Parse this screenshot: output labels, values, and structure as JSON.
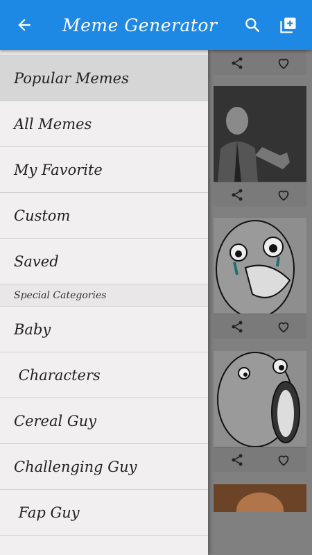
{
  "appbar": {
    "title": "Meme Generator",
    "color": "#1e88e5",
    "icons": [
      "back-arrow-icon",
      "search-icon",
      "add-box-icon"
    ]
  },
  "drawer": {
    "items_top": [
      {
        "label": "Popular Memes",
        "active": true
      },
      {
        "label": "All Memes"
      },
      {
        "label": "My Favorite"
      },
      {
        "label": "Custom"
      },
      {
        "label": "Saved"
      }
    ],
    "section_title": "Special Categories",
    "items_special": [
      {
        "label": "Baby"
      },
      {
        "label": " Characters"
      },
      {
        "label": "Cereal Guy"
      },
      {
        "label": "Challenging Guy"
      },
      {
        "label": " Fap Guy"
      }
    ]
  },
  "content": {
    "card_icons": [
      "share-icon",
      "heart-outline-icon"
    ]
  }
}
